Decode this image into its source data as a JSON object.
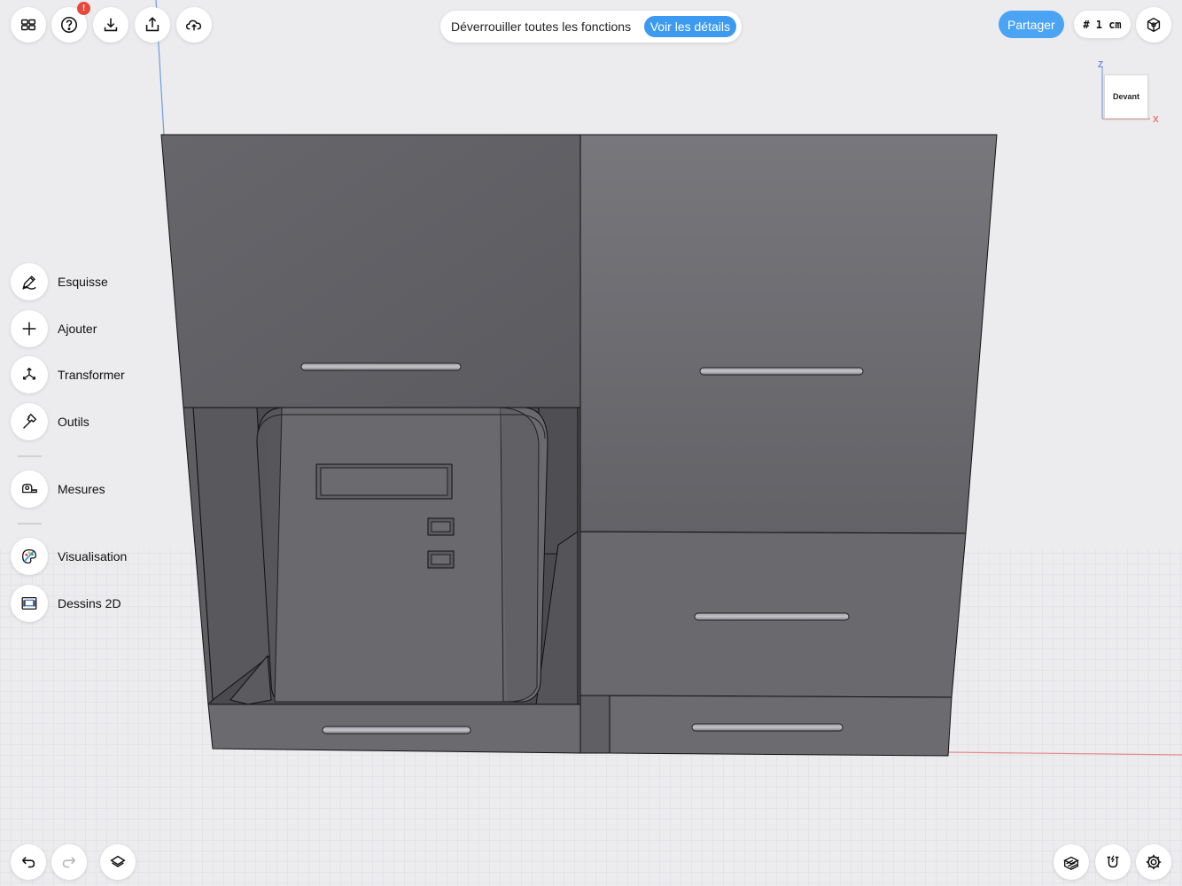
{
  "topbar": {
    "home_icon": "grid-icon",
    "help_icon": "question-icon",
    "help_badge": "!",
    "import_icon": "download-icon",
    "export_icon": "share-upload-icon",
    "cloud_icon": "cloud-upload-icon"
  },
  "banner": {
    "text": "Déverrouiller toutes les fonctions",
    "button": "Voir les détails"
  },
  "share_label": "Partager",
  "grid_size": "# 1 cm",
  "view_cube": {
    "face": "Devant",
    "axis_z": "Z",
    "axis_x": "X"
  },
  "tools": [
    {
      "label": "Esquisse",
      "icon": "pencil-icon"
    },
    {
      "label": "Ajouter",
      "icon": "plus-icon"
    },
    {
      "label": "Transformer",
      "icon": "move-arrows-icon"
    },
    {
      "label": "Outils",
      "icon": "hammer-icon"
    },
    {
      "label": "Mesures",
      "icon": "tape-measure-icon"
    },
    {
      "label": "Visualisation",
      "icon": "palette-icon"
    },
    {
      "label": "Dessins 2D",
      "icon": "drawing-sheet-icon"
    }
  ],
  "bottombar": {
    "undo_icon": "undo-icon",
    "redo_icon": "redo-icon",
    "layers_icon": "layers-icon",
    "section_icon": "section-plane-icon",
    "snap_icon": "magnet-icon",
    "settings_icon": "gear-icon"
  },
  "colors": {
    "accent": "#3c9bf0",
    "badge": "#e5483b",
    "model_face": "#6a6a6f",
    "background": "#ececef"
  }
}
